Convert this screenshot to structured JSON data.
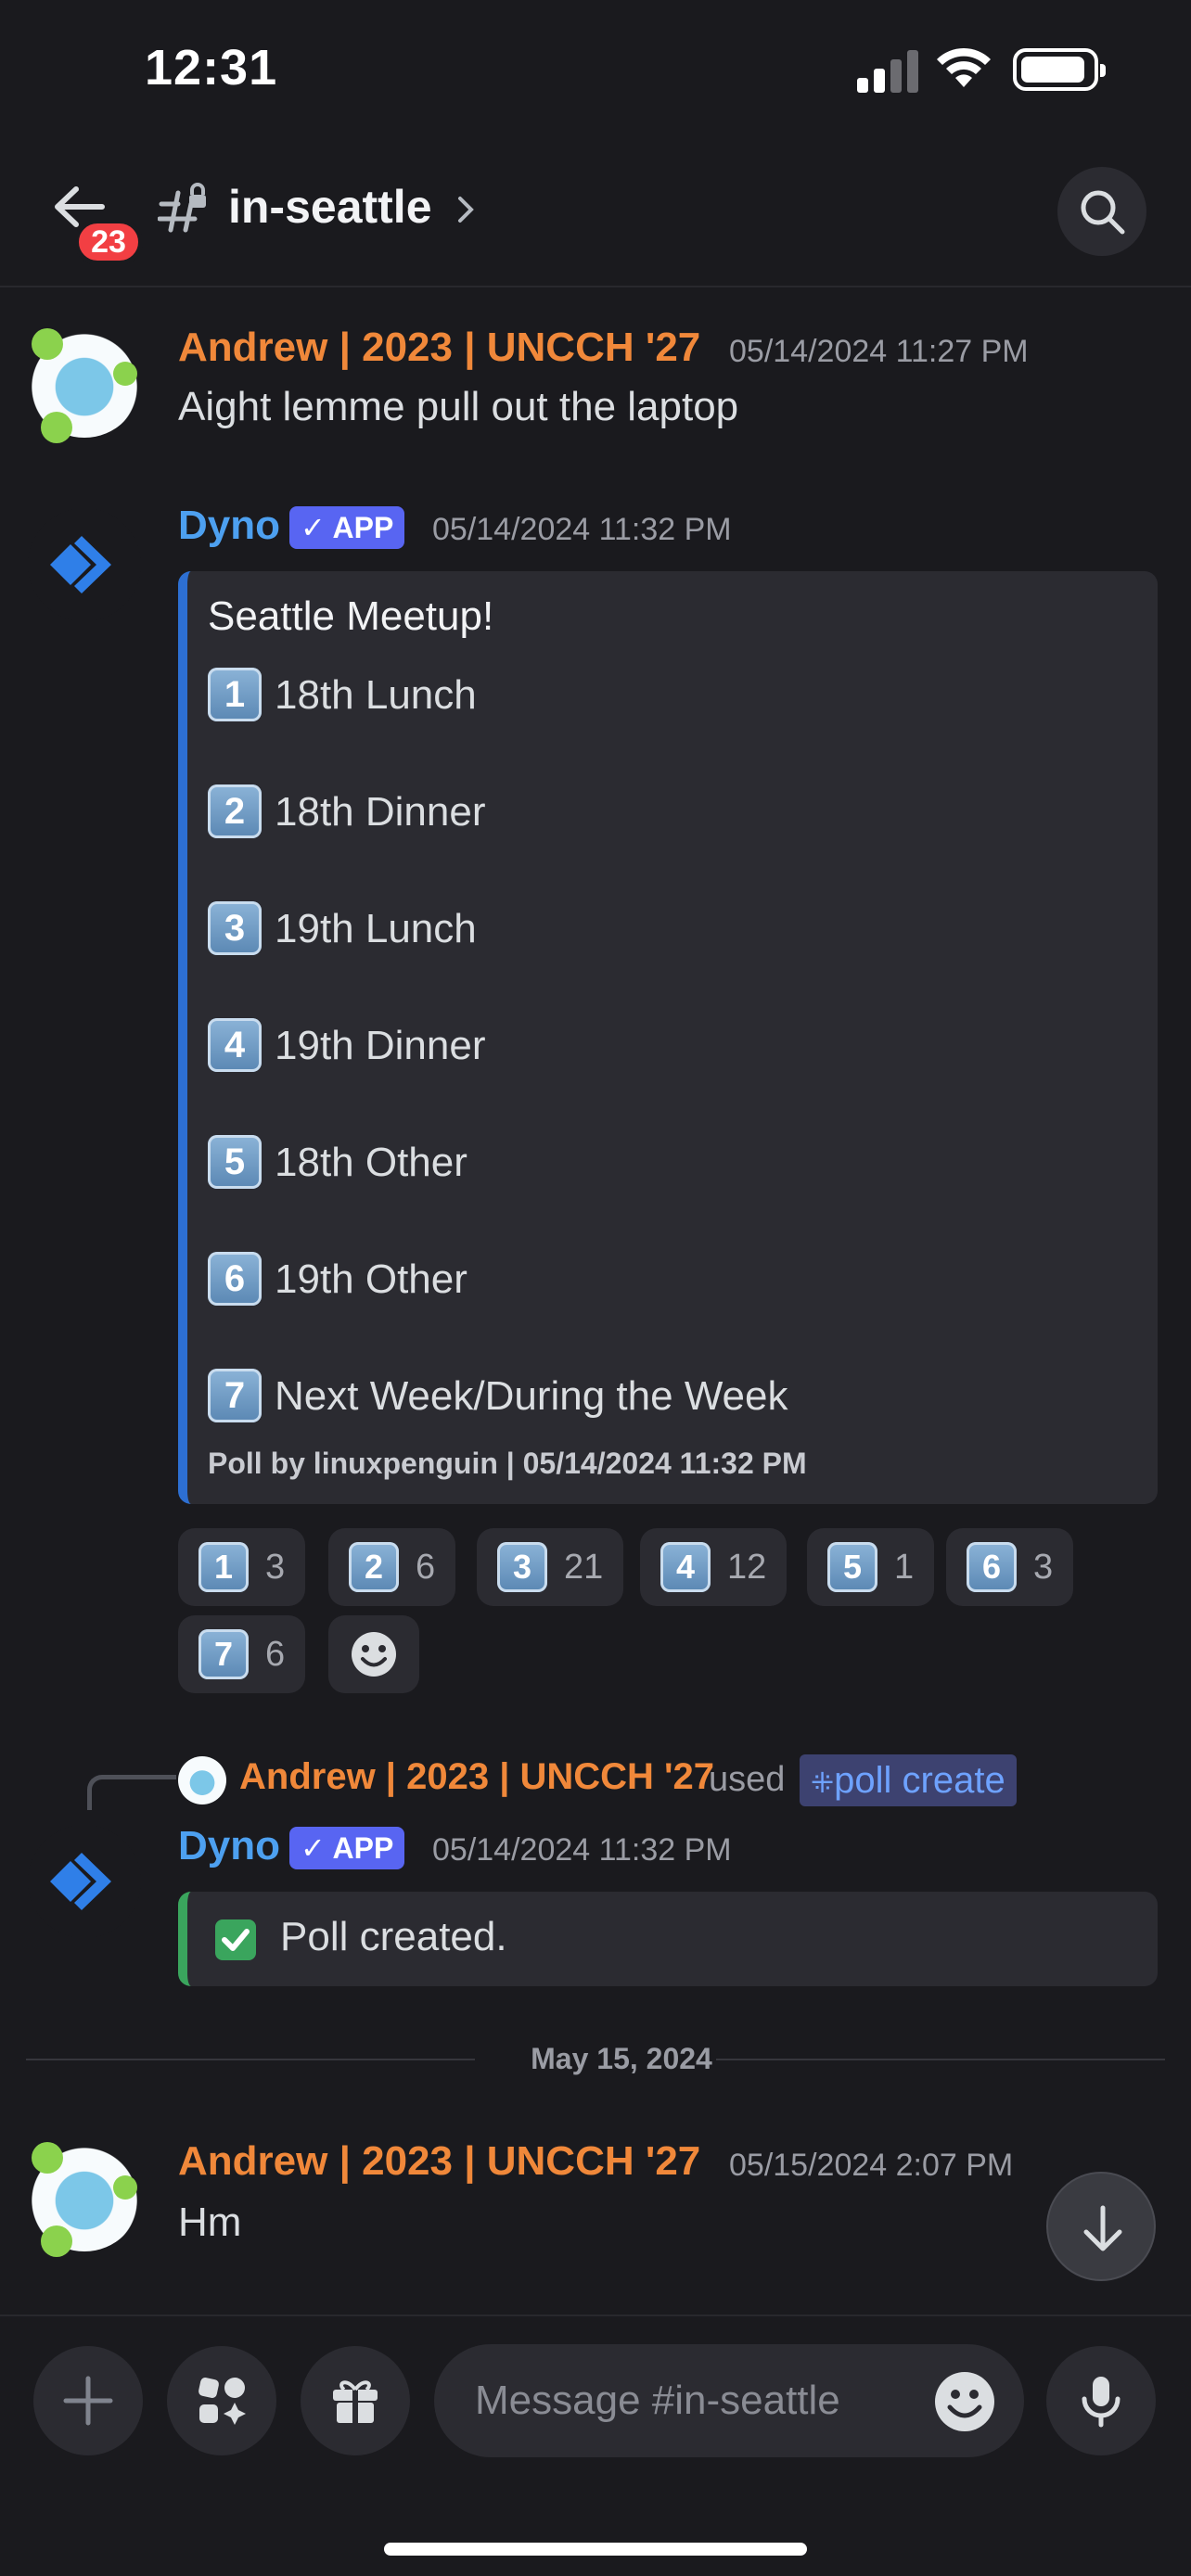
{
  "status_bar": {
    "time": "12:31"
  },
  "header": {
    "channel": "in-seattle",
    "unread_badge": "23"
  },
  "messages": [
    {
      "username": "Andrew | 2023 | UNCCH '27",
      "timestamp": "05/14/2024 11:27 PM",
      "text": "Aight lemme pull out the laptop"
    },
    {
      "username": "Dyno",
      "app_tag": "APP",
      "timestamp": "05/14/2024 11:32 PM",
      "embed": {
        "title": "Seattle Meetup!",
        "options": [
          {
            "key": "1",
            "label": "18th Lunch"
          },
          {
            "key": "2",
            "label": "18th Dinner"
          },
          {
            "key": "3",
            "label": "19th Lunch"
          },
          {
            "key": "4",
            "label": "19th Dinner"
          },
          {
            "key": "5",
            "label": "18th Other"
          },
          {
            "key": "6",
            "label": "19th Other"
          },
          {
            "key": "7",
            "label": "Next Week/During the Week"
          }
        ],
        "footer": "Poll by linuxpenguin | 05/14/2024 11:32 PM"
      },
      "reactions": [
        {
          "key": "1",
          "count": "3"
        },
        {
          "key": "2",
          "count": "6"
        },
        {
          "key": "3",
          "count": "21"
        },
        {
          "key": "4",
          "count": "12"
        },
        {
          "key": "5",
          "count": "1"
        },
        {
          "key": "6",
          "count": "3"
        },
        {
          "key": "7",
          "count": "6"
        }
      ]
    },
    {
      "reply_user": "Andrew | 2023 | UNCCH '27",
      "reply_used": "used",
      "reply_command": "poll create",
      "username": "Dyno",
      "app_tag": "APP",
      "timestamp": "05/14/2024 11:32 PM",
      "result_text": "Poll created."
    },
    {
      "username": "Andrew | 2023 | UNCCH '27",
      "timestamp": "05/15/2024 2:07 PM",
      "text": "Hm"
    }
  ],
  "date_divider": "May 15, 2024",
  "composer": {
    "placeholder": "Message #in-seattle"
  },
  "colors": {
    "background": "#1a1a1e",
    "username_orange": "#f0883a",
    "username_blue": "#4da0f0",
    "blurple": "#5865f2",
    "embed_border": "#2d6fd2",
    "success_green": "#3aa55d",
    "badge_red": "#f23f43"
  },
  "icons": [
    "back-arrow-icon",
    "channel-hash-lock-icon",
    "chevron-right-icon",
    "search-icon",
    "plus-icon",
    "apps-icon",
    "gift-icon",
    "emoji-icon",
    "microphone-icon",
    "arrow-down-icon",
    "checkmark-icon"
  ]
}
